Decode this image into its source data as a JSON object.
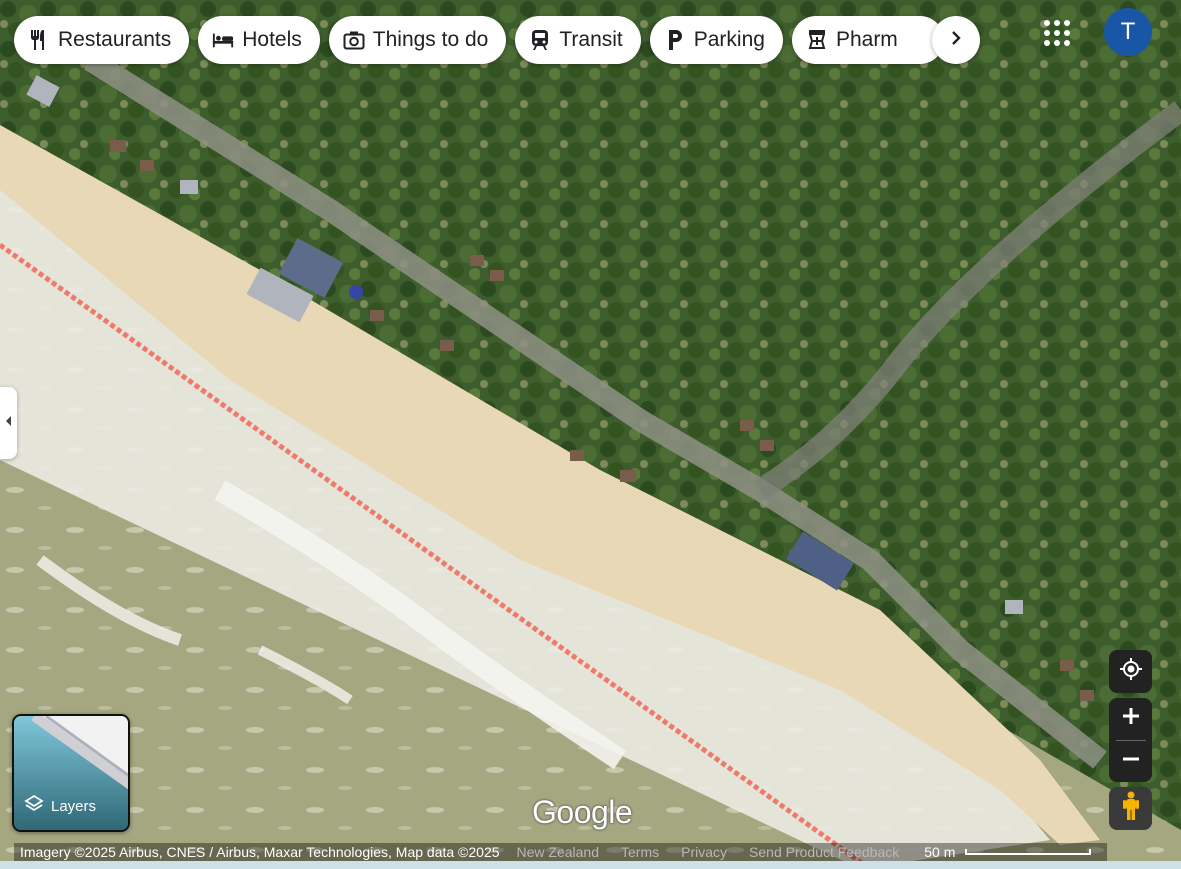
{
  "chips": [
    {
      "label": "Restaurants",
      "icon": "fork-knife-icon"
    },
    {
      "label": "Hotels",
      "icon": "bed-icon"
    },
    {
      "label": "Things to do",
      "icon": "camera-icon"
    },
    {
      "label": "Transit",
      "icon": "train-icon"
    },
    {
      "label": "Parking",
      "icon": "parking-icon"
    },
    {
      "label": "Pharm",
      "icon": "pharmacy-icon"
    }
  ],
  "account": {
    "initial": "T",
    "color": "#1a56a6"
  },
  "layers": {
    "label": "Layers"
  },
  "logo": "Google",
  "footer": {
    "imagery": "Imagery ©2025 Airbus, CNES / Airbus, Maxar Technologies, Map data ©2025",
    "region": "New Zealand",
    "terms": "Terms",
    "privacy": "Privacy",
    "feedback": "Send Product Feedback",
    "scale": "50 m"
  },
  "colors": {
    "forest": "#3b5a2c",
    "sand": "#e8d7b5",
    "sea": "#9fa57d",
    "surf": "#f2f2ee",
    "boundary": "#f07a6a"
  }
}
